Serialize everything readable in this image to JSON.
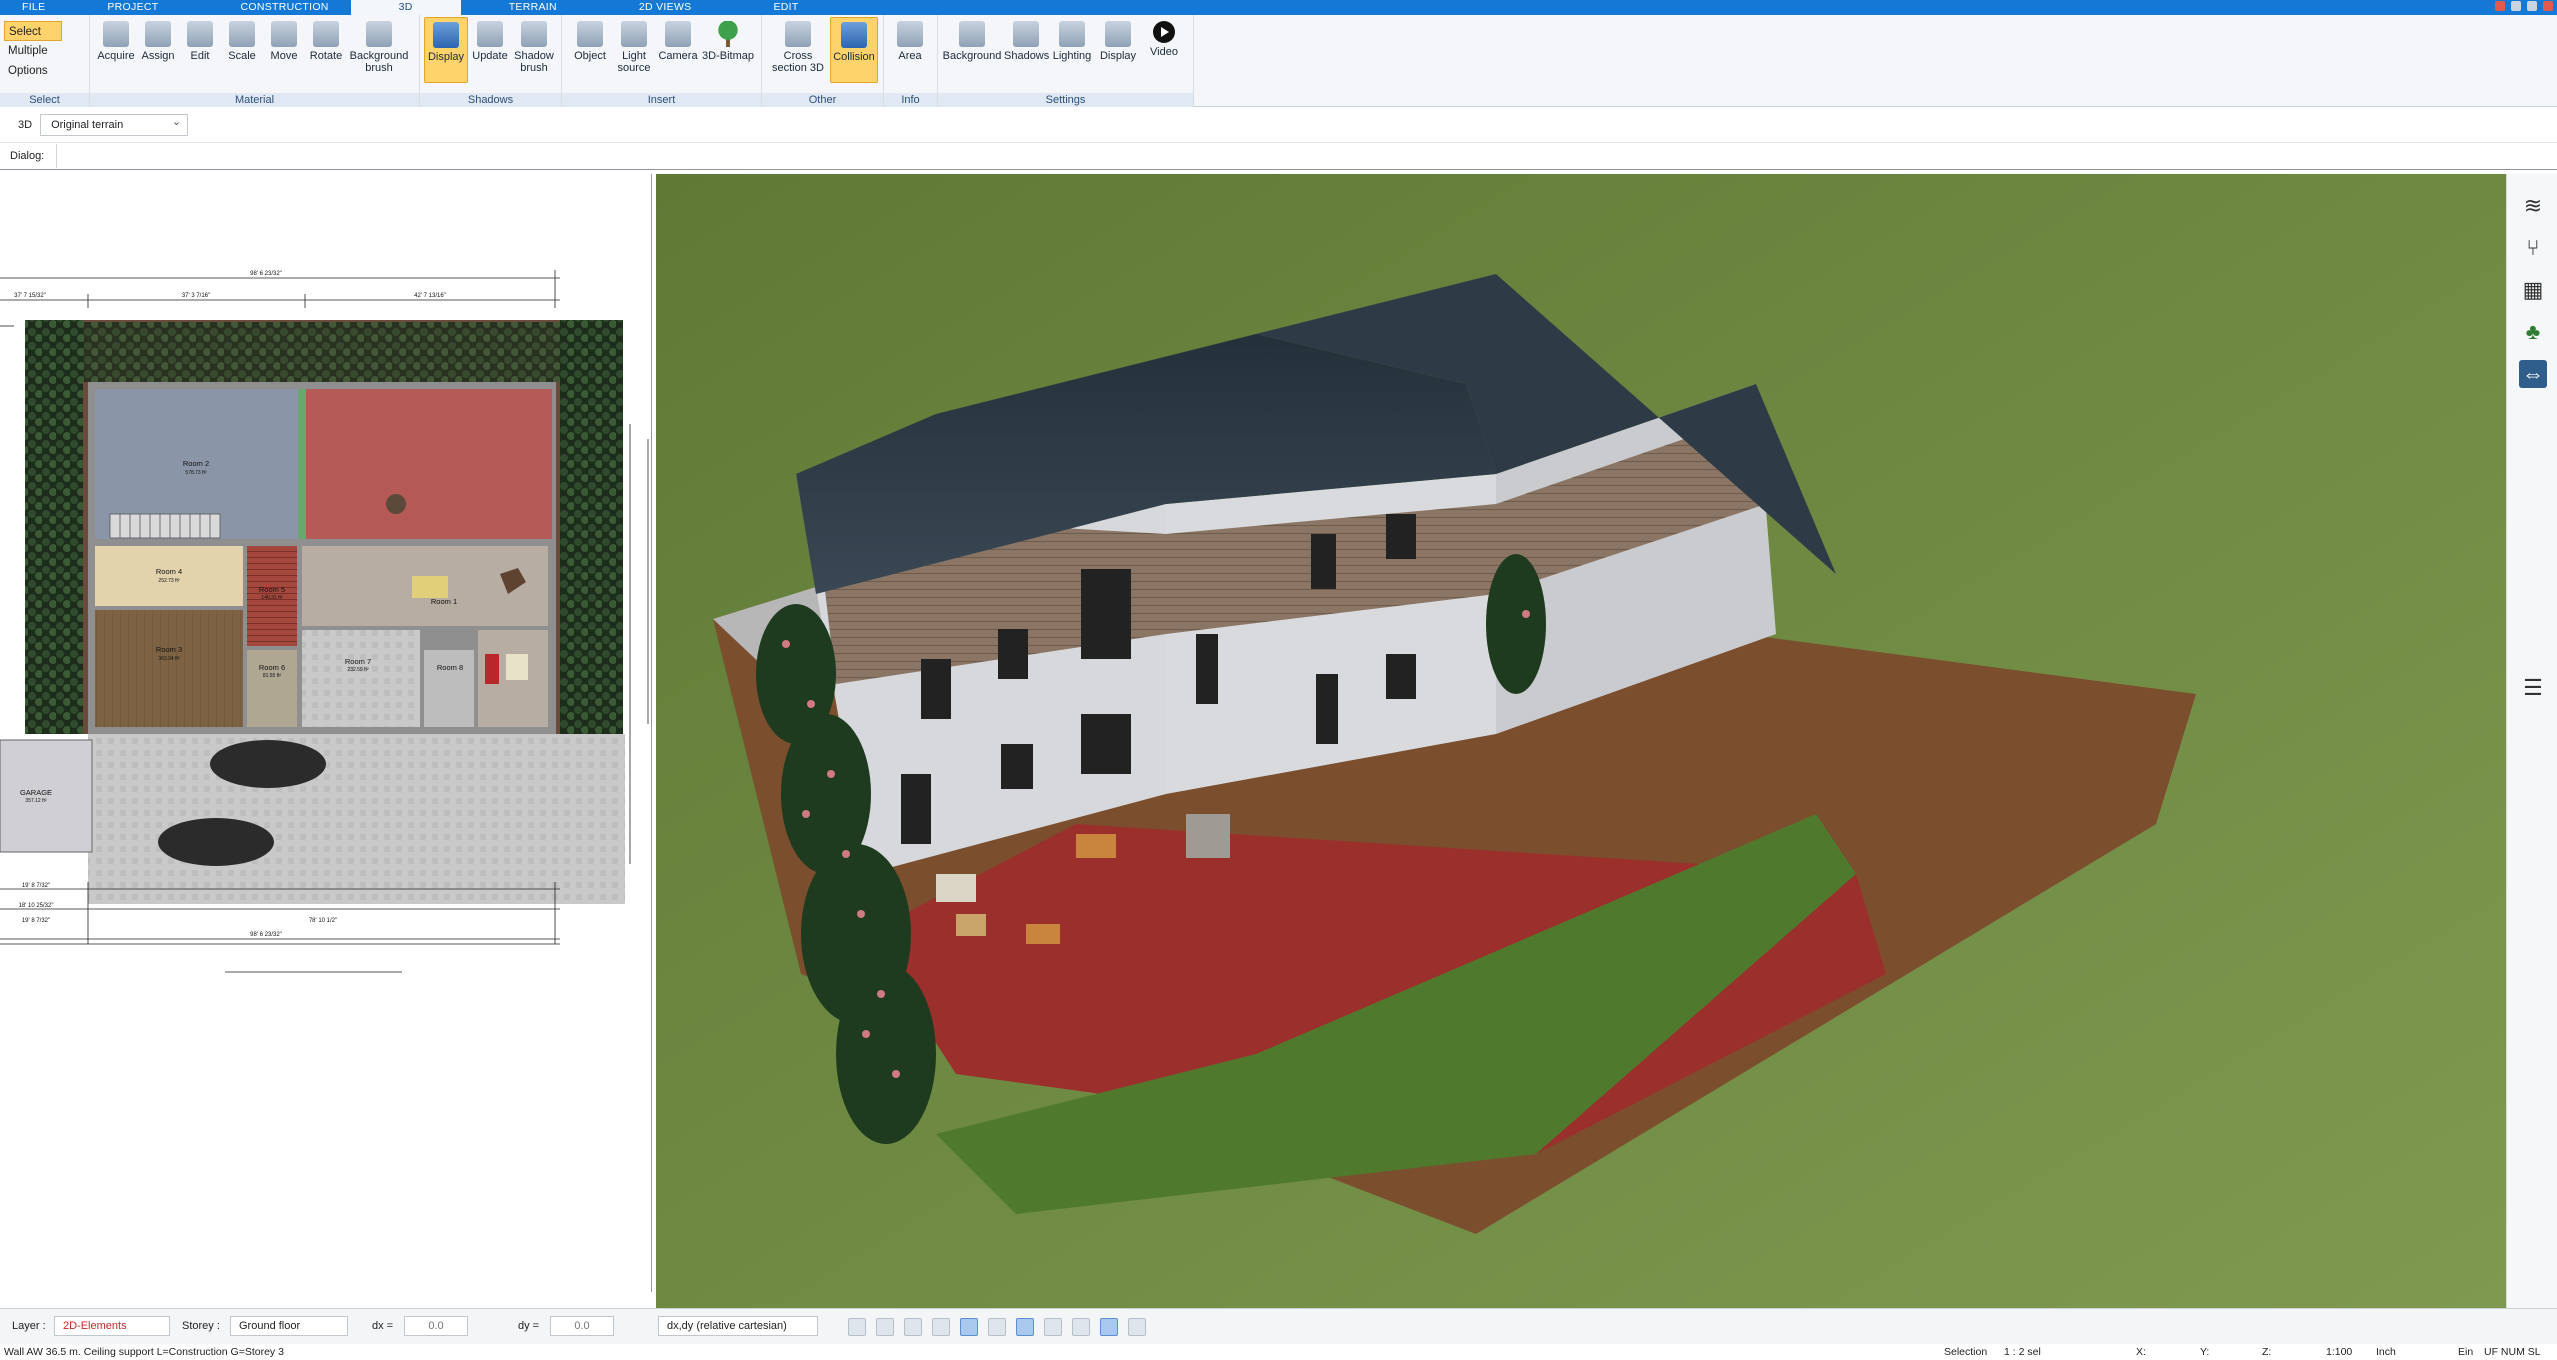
{
  "tabs": [
    "FILE",
    "PROJECT",
    "CONSTRUCTION",
    "3D",
    "TERRAIN",
    "2D VIEWS",
    "EDIT"
  ],
  "active_tab": "3D",
  "ribbon": {
    "select_group": {
      "select": "Select",
      "multiple": "Multiple",
      "options": "Options",
      "label": "Select"
    },
    "material_group": {
      "label": "Material",
      "buttons": [
        "Acquire",
        "Assign",
        "Edit",
        "Scale",
        "Move",
        "Rotate",
        "Background brush"
      ]
    },
    "shadows_group": {
      "label": "Shadows",
      "buttons": [
        "Display",
        "Update",
        "Shadow brush"
      ]
    },
    "insert_group": {
      "label": "Insert",
      "buttons": [
        "Object",
        "Light source",
        "Camera",
        "3D-Bitmap"
      ]
    },
    "other_group": {
      "label": "Other",
      "buttons": [
        "Cross section 3D",
        "Collision"
      ]
    },
    "info_group": {
      "label": "Info",
      "buttons": [
        "Area"
      ]
    },
    "settings_group": {
      "label": "Settings",
      "buttons": [
        "Background",
        "Shadows",
        "Lighting",
        "Display",
        "Video"
      ]
    }
  },
  "options": {
    "mode": "3D",
    "terrain_select": "Original terrain",
    "dialog_label": "Dialog:"
  },
  "plan": {
    "rooms": [
      {
        "name": "Room 2",
        "area": "578.73 ft²"
      },
      {
        "name": "Room 4",
        "area": "252.73 ft²"
      },
      {
        "name": "Room 3",
        "area": "363.34 ft²"
      },
      {
        "name": "Room 5",
        "area": "140.31 ft²"
      },
      {
        "name": "Room 1",
        "area": ""
      },
      {
        "name": "Room 6",
        "area": "81.55 ft²"
      },
      {
        "name": "Room 7",
        "area": "232.59 ft²"
      },
      {
        "name": "Room 8",
        "area": ""
      },
      {
        "name": "GARAGE",
        "area": "357.12 ft²"
      }
    ],
    "dims_top": {
      "overall": "98' 6 23/32\"",
      "left": "37' 7 15/32\"",
      "mid": "37' 3 7/16\"",
      "right": "42' 7 13/16\""
    },
    "dims_bottom": {
      "a": "19' 8 7/32\"",
      "b": "18' 10 25/32\"",
      "c": "78' 10 1/2\"",
      "d": "19' 8 7/32\"",
      "overall": "98' 6 23/32\""
    }
  },
  "status": {
    "layer_label": "Layer :",
    "layer_value": "2D-Elements",
    "storey_label": "Storey :",
    "storey_value": "Ground floor",
    "dx_label": "dx =",
    "dx_value": "0.0",
    "dy_label": "dy =",
    "dy_value": "0.0",
    "coord_mode": "dx,dy (relative cartesian)"
  },
  "bottom": {
    "message": "Wall AW 36.5 m. Ceiling support L=Construction G=Storey 3",
    "selection_label": "Selection",
    "selection_value": "1 : 2 sel",
    "x": "X:",
    "y": "Y:",
    "z": "Z:",
    "scale": "1:100",
    "unit": "Inch",
    "ein": "Ein",
    "uf": "UF NUM SL"
  },
  "colors": {
    "tab_bar": "#1479d6",
    "selected": "#ffd36b",
    "lawn": "#6f8a3e",
    "roof": "#2f3a44",
    "terrace": "#9b2f2c"
  }
}
